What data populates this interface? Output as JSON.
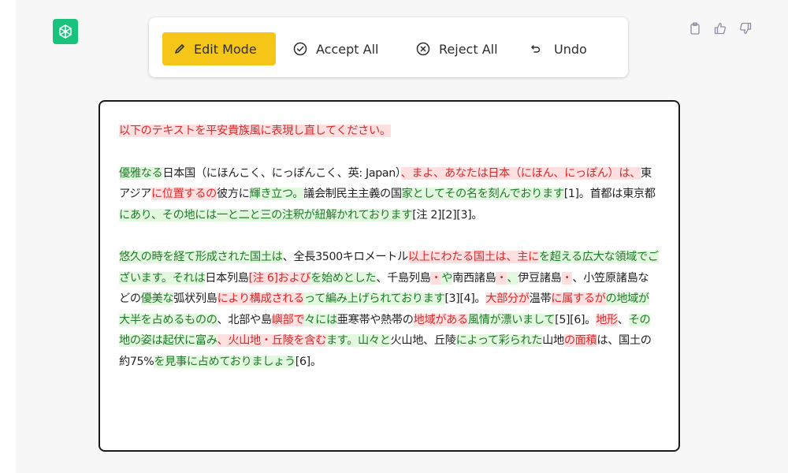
{
  "toolbar": {
    "edit_mode_label": "Edit Mode",
    "accept_all_label": "Accept All",
    "reject_all_label": "Reject All",
    "undo_label": "Undo"
  },
  "colors": {
    "edit_button_bg": "#f5c518",
    "deleted_text": "#d92b2b",
    "deleted_bg": "#ffdfe0",
    "inserted_text": "#207a2b",
    "inserted_bg": "#e3f9df",
    "avatar_bg": "#19c37d"
  },
  "icons": {
    "avatar": "openai-logo-icon",
    "edit": "pencil-icon",
    "accept": "check-circle-icon",
    "reject": "x-circle-icon",
    "undo": "undo-arrow-icon",
    "copy": "clipboard-icon",
    "like": "thumbs-up-icon",
    "dislike": "thumbs-down-icon"
  },
  "document": {
    "paragraphs": [
      {
        "segments": [
          {
            "t": "r",
            "text": "以下のテキストを平安貴族風に表現し直してください。"
          }
        ]
      },
      {
        "segments": [
          {
            "t": "g",
            "text": "優雅なる"
          },
          {
            "t": "n",
            "text": "日本国（にほんこく、にっぽんこく、英: Japan）"
          },
          {
            "t": "r",
            "text": "、まよ、あなたは日本（にほん、にっぽん）は、"
          },
          {
            "t": "n",
            "text": "東アジア"
          },
          {
            "t": "r",
            "text": "に位置するの"
          },
          {
            "t": "n",
            "text": "彼方に"
          },
          {
            "t": "g",
            "text": "輝き立つ。"
          },
          {
            "t": "n",
            "text": "議会制民主主義の国"
          },
          {
            "t": "g",
            "text": "家としてその名を刻んでおります"
          },
          {
            "t": "n",
            "text": "[1]。首都は東京都"
          },
          {
            "t": "g",
            "text": "にあり、その地には一と二と三の注釈が紐解かれております"
          },
          {
            "t": "n",
            "text": "[注 2][2][3]。"
          }
        ]
      },
      {
        "segments": [
          {
            "t": "g",
            "text": "悠久の時を経て形成された国土は"
          },
          {
            "t": "n",
            "text": "、全長3500キロメートル"
          },
          {
            "t": "r",
            "text": "以上にわたる国土は、主に"
          },
          {
            "t": "g",
            "text": "を超える広大な領域でございます。それは"
          },
          {
            "t": "n",
            "text": "日本列島"
          },
          {
            "t": "r",
            "text": "[注 6]および"
          },
          {
            "t": "g",
            "text": "を始めとした"
          },
          {
            "t": "n",
            "text": "、千島列島"
          },
          {
            "t": "r",
            "text": "・"
          },
          {
            "t": "g",
            "text": "や"
          },
          {
            "t": "n",
            "text": "南西諸島"
          },
          {
            "t": "r",
            "text": "・"
          },
          {
            "t": "g",
            "text": "、"
          },
          {
            "t": "n",
            "text": "伊豆諸島"
          },
          {
            "t": "r",
            "text": "・"
          },
          {
            "t": "n",
            "text": "、小笠原諸島などの"
          },
          {
            "t": "g",
            "text": "優美な"
          },
          {
            "t": "n",
            "text": "弧状列島"
          },
          {
            "t": "r",
            "text": "により構成される"
          },
          {
            "t": "g",
            "text": "って編み上げられております"
          },
          {
            "t": "n",
            "text": "[3][4]。"
          },
          {
            "t": "r",
            "text": "大部分が"
          },
          {
            "t": "n",
            "text": "温帯"
          },
          {
            "t": "r",
            "text": "に属するが"
          },
          {
            "t": "g",
            "text": "の地域が大半を占めるものの"
          },
          {
            "t": "n",
            "text": "、北部や島"
          },
          {
            "t": "r",
            "text": "嶼部で"
          },
          {
            "t": "g",
            "text": "々には"
          },
          {
            "t": "n",
            "text": "亜寒帯や熱帯の"
          },
          {
            "t": "r",
            "text": "地域がある"
          },
          {
            "t": "g",
            "text": "風情が漂いまして"
          },
          {
            "t": "n",
            "text": "[5][6]。"
          },
          {
            "t": "r",
            "text": "地形"
          },
          {
            "t": "n",
            "text": "、"
          },
          {
            "t": "g",
            "text": "その地の姿は起伏に富み"
          },
          {
            "t": "r",
            "text": "、火山地・丘陵を含む"
          },
          {
            "t": "g",
            "text": "ます。山々と"
          },
          {
            "t": "n",
            "text": "火山地、丘陵"
          },
          {
            "t": "g",
            "text": "によって彩られた"
          },
          {
            "t": "n",
            "text": "山地"
          },
          {
            "t": "r",
            "text": "の面積"
          },
          {
            "t": "n",
            "text": "は、国土の約75%"
          },
          {
            "t": "g",
            "text": "を見事に占めておりましょう"
          },
          {
            "t": "n",
            "text": "[6]。"
          }
        ]
      }
    ]
  }
}
